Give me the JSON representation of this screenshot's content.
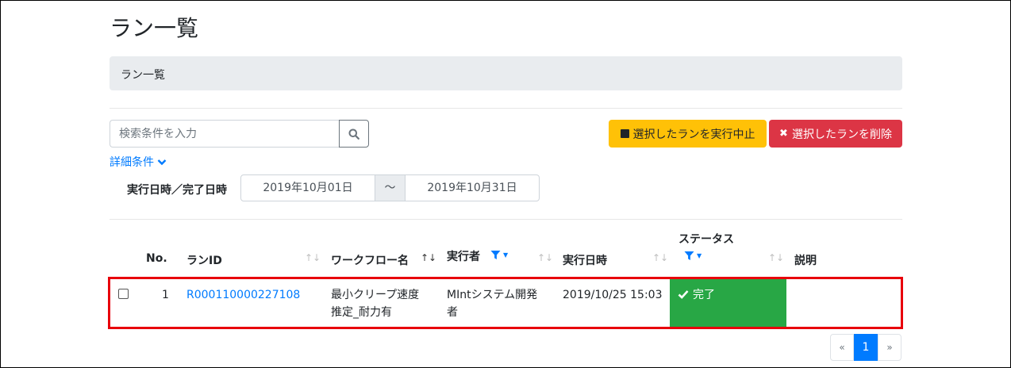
{
  "page": {
    "title": "ラン一覧"
  },
  "breadcrumb": {
    "label": "ラン一覧"
  },
  "search": {
    "placeholder": "検索条件を入力",
    "value": ""
  },
  "actions": {
    "stop_label": "選択したランを実行中止",
    "delete_label": "選択したランを削除"
  },
  "detail": {
    "label": "詳細条件"
  },
  "date_filter": {
    "label": "実行日時／完了日時",
    "from": "2019年10月01日",
    "separator": "～",
    "to": "2019年10月31日"
  },
  "table": {
    "headers": {
      "no": "No.",
      "run_id": "ランID",
      "workflow": "ワークフロー名",
      "executor": "実行者",
      "exec_datetime": "実行日時",
      "status": "ステータス",
      "description": "説明"
    },
    "rows": [
      {
        "no": "1",
        "run_id": "R000110000227108",
        "workflow_line1": "最小クリープ速度",
        "workflow_line2": "推定_耐力有",
        "executor_line1": "MIntシステム開発",
        "executor_line2": "者",
        "exec_datetime": "2019/10/25 15:03",
        "status": "完了",
        "description": ""
      }
    ]
  },
  "pagination": {
    "prev": "«",
    "current": "1",
    "next": "»"
  },
  "colors": {
    "primary": "#007bff",
    "warning": "#ffc107",
    "danger": "#dc3545",
    "success": "#28a745",
    "highlight": "#e8000b"
  }
}
